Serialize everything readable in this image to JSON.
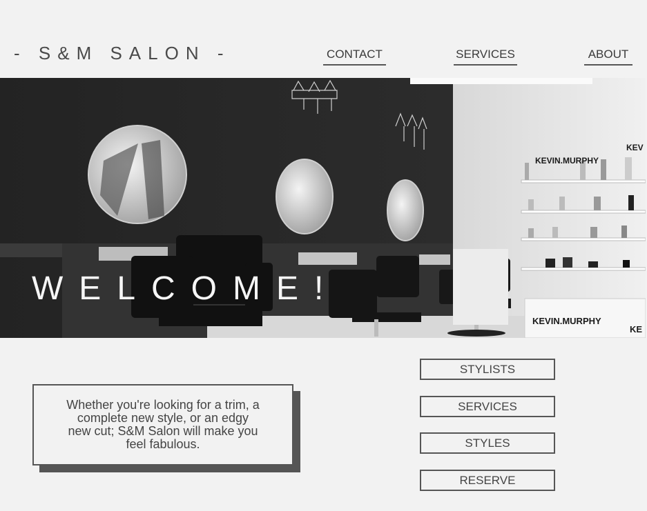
{
  "brand": {
    "title": "- S&M SALON -"
  },
  "nav": {
    "contact": "CONTACT",
    "services": "SERVICES",
    "about": "ABOUT"
  },
  "hero": {
    "heading": "WELCOME!",
    "shelf_brand_1": "KEVIN.MURPHY",
    "shelf_brand_2": "KEVIN.MURPHY",
    "shelf_brand_3": "KEV",
    "shelf_brand_4": "KE"
  },
  "promo": {
    "text": "Whether you're looking for a trim, a complete new style, or an edgy new cut; S&M Salon will make you feel fabulous."
  },
  "buttons": {
    "stylists": "STYLISTS",
    "services": "SERVICES",
    "styles": "STYLES",
    "reserve": "RESERVE"
  },
  "colors": {
    "background": "#f2f2f2",
    "text": "#444444",
    "border": "#555555"
  }
}
